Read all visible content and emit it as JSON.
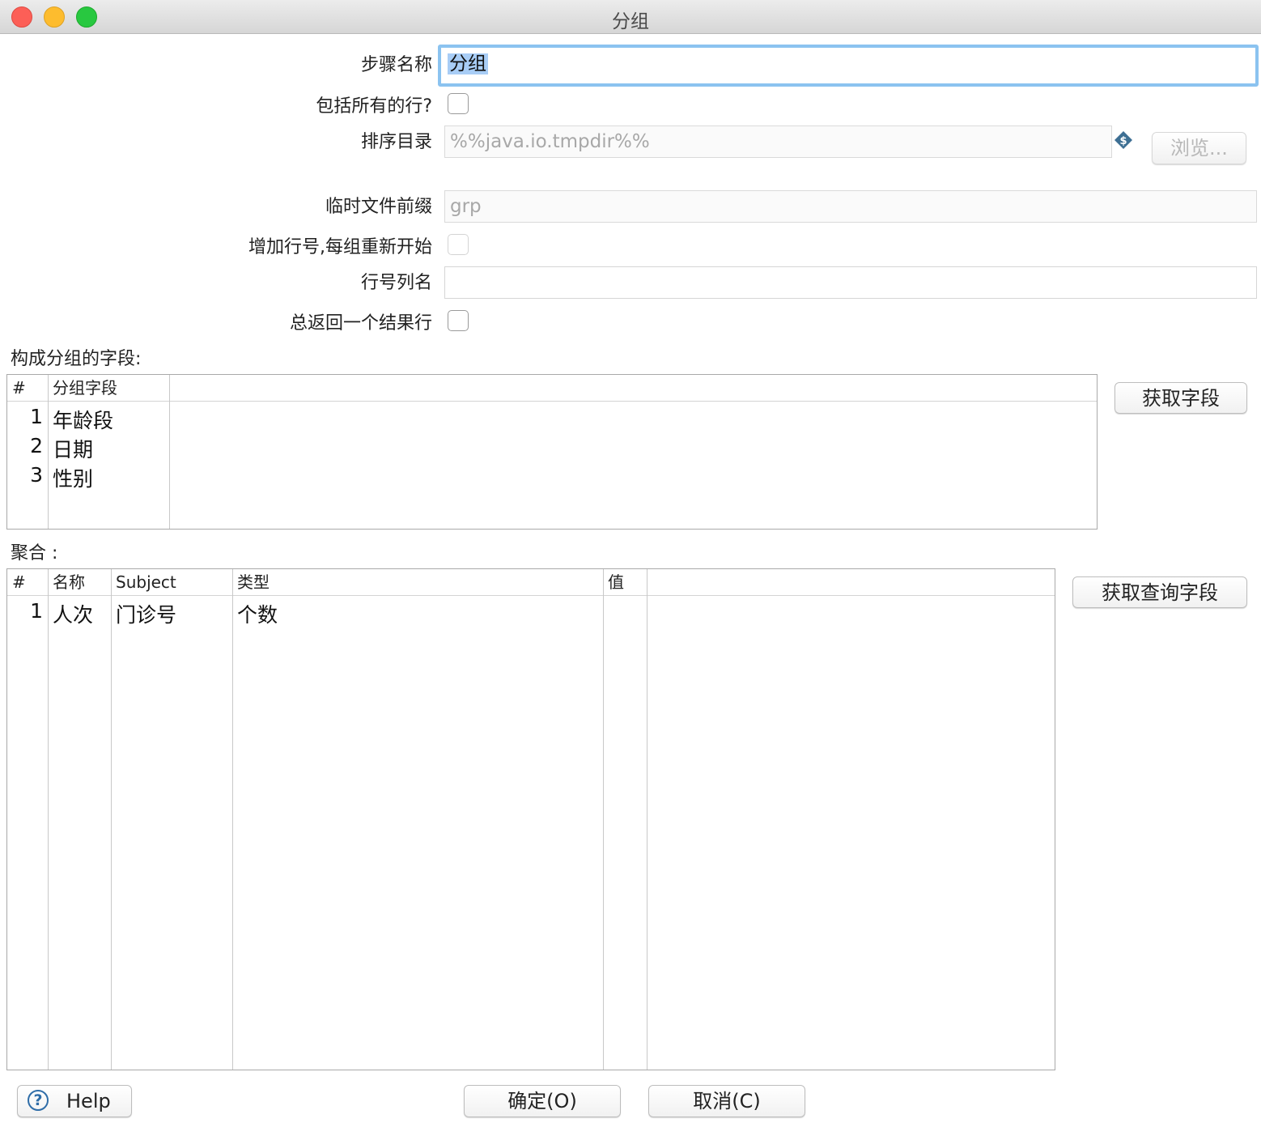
{
  "window": {
    "title": "分组"
  },
  "form": {
    "step_name_label": "步骤名称",
    "step_name_value": "分组",
    "include_all_rows_label": "包括所有的行?",
    "sort_dir_label": "排序目录",
    "sort_dir_value": "%%java.io.tmpdir%%",
    "browse_label": "浏览...",
    "temp_prefix_label": "临时文件前缀",
    "temp_prefix_value": "grp",
    "add_line_number_label": "增加行号,每组重新开始",
    "line_number_field_label": "行号列名",
    "line_number_field_value": "",
    "always_return_row_label": "总返回一个结果行"
  },
  "group_fields": {
    "section_label": "构成分组的字段:",
    "get_fields_label": "获取字段",
    "columns": [
      "#",
      "分组字段"
    ],
    "rows": [
      {
        "num": "1",
        "field": "年龄段"
      },
      {
        "num": "2",
        "field": "日期"
      },
      {
        "num": "3",
        "field": "性别"
      }
    ]
  },
  "aggregates": {
    "section_label": "聚合 :",
    "get_lookup_fields_label": "获取查询字段",
    "columns": [
      "#",
      "名称",
      "Subject",
      "类型",
      "值"
    ],
    "rows": [
      {
        "num": "1",
        "name": "人次",
        "subject": "门诊号",
        "type": "个数",
        "value": ""
      }
    ]
  },
  "footer": {
    "help_label": "Help",
    "ok_label": "确定(O)",
    "cancel_label": "取消(C)"
  },
  "icons": {
    "help": "help-circle-icon",
    "variable": "dollar-diamond-icon"
  }
}
